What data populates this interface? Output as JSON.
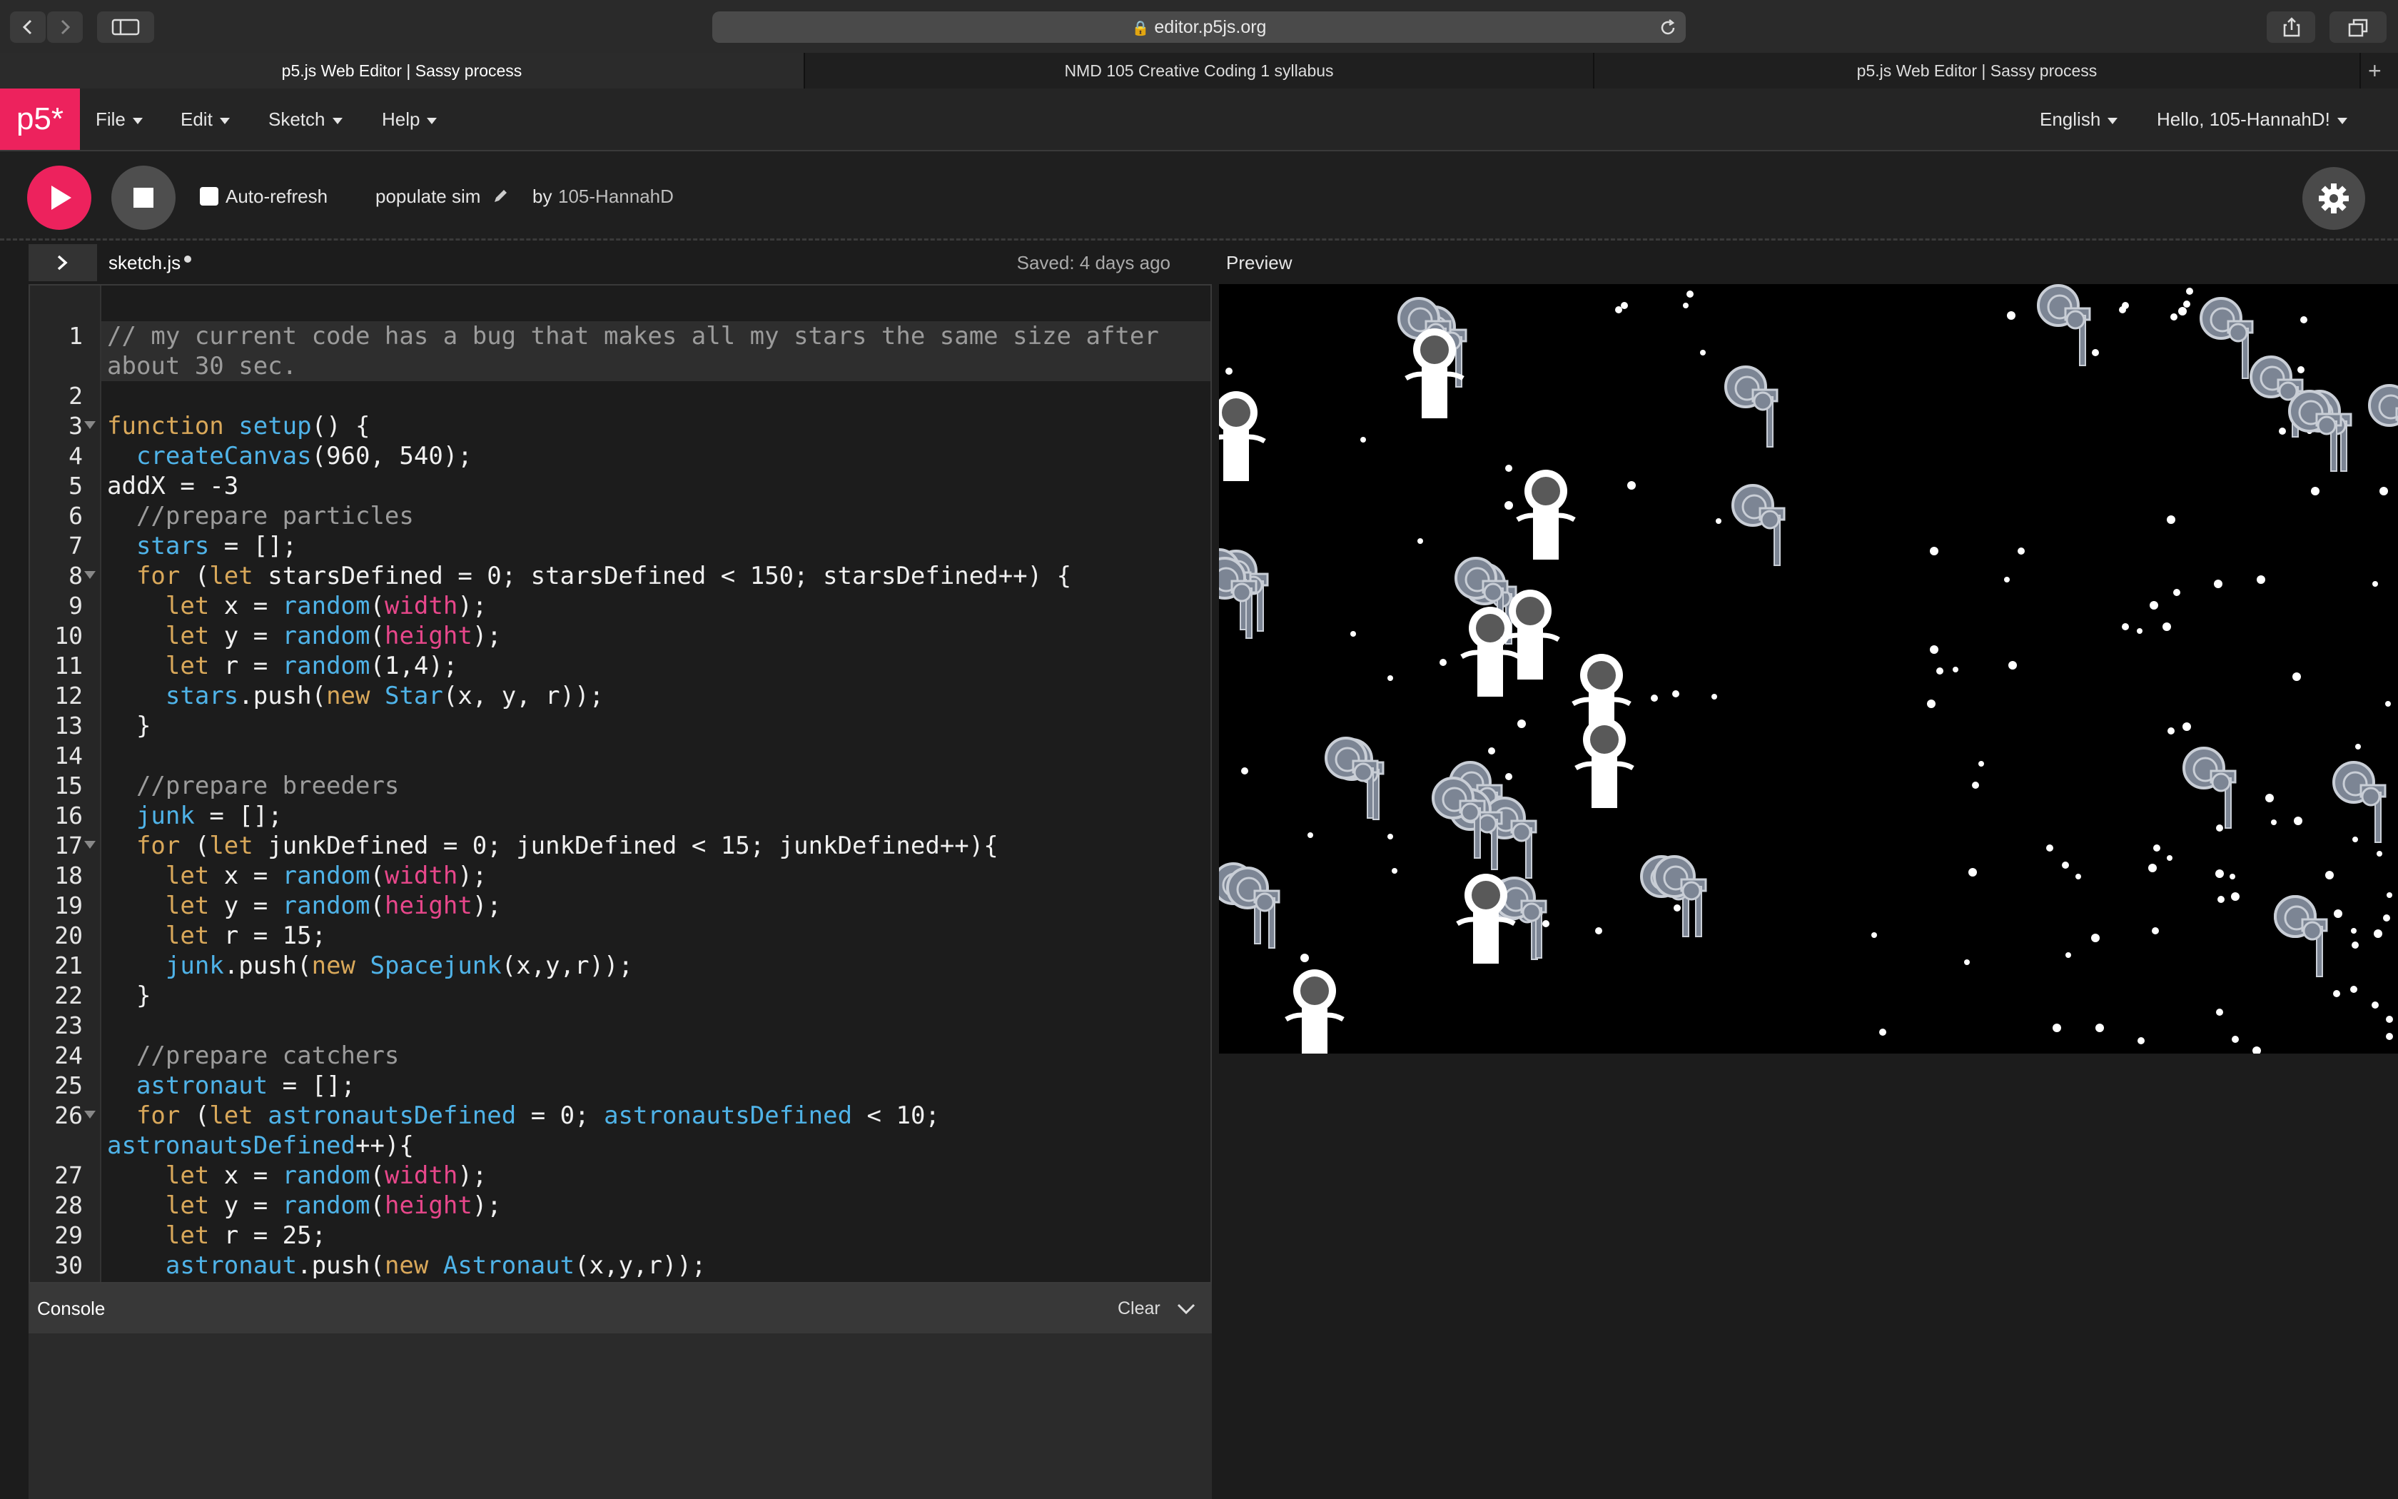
{
  "browser": {
    "url": "editor.p5js.org",
    "tabs": [
      {
        "title": "p5.js Web Editor | Sassy process",
        "active": true
      },
      {
        "title": "NMD 105 Creative Coding 1 syllabus",
        "active": false
      },
      {
        "title": "p5.js Web Editor | Sassy process",
        "active": false
      }
    ]
  },
  "nav": {
    "logo": "p5*",
    "menus": [
      "File",
      "Edit",
      "Sketch",
      "Help"
    ],
    "language": "English",
    "user": "Hello, 105-HannahD!"
  },
  "toolbar": {
    "auto_refresh_label": "Auto-refresh",
    "auto_refresh_checked": false,
    "sketch_name": "populate sim",
    "by_label": "by",
    "author": "105-HannahD"
  },
  "editor": {
    "file_name": "sketch.js",
    "saved_status": "Saved: 4 days ago",
    "line_numbers": [
      "1",
      "",
      "2",
      "3",
      "4",
      "5",
      "6",
      "7",
      "8",
      "9",
      "10",
      "11",
      "12",
      "13",
      "14",
      "15",
      "16",
      "17",
      "18",
      "19",
      "20",
      "21",
      "22",
      "23",
      "24",
      "25",
      "26",
      "",
      "27",
      "28",
      "29",
      "30"
    ],
    "code_lines": [
      "// my current code has a bug that makes all my stars the same size after",
      "about 30 sec.",
      "",
      "function setup() {",
      "  createCanvas(960, 540);",
      "addX = -3",
      "  //prepare particles",
      "  stars = [];",
      "  for (let starsDefined = 0; starsDefined < 150; starsDefined++) {",
      "    let x = random(width);",
      "    let y = random(height);",
      "    let r = random(1,4);",
      "    stars.push(new Star(x, y, r));",
      "  }",
      "",
      "  //prepare breeders",
      "  junk = [];",
      "  for (let junkDefined = 0; junkDefined < 15; junkDefined++){",
      "    let x = random(width);",
      "    let y = random(height);",
      "    let r = 15;",
      "    junk.push(new Spacejunk(x,y,r));",
      "  }",
      "",
      "  //prepare catchers",
      "  astronaut = [];",
      "  for (let astronautsDefined = 0; astronautsDefined < 10;",
      "astronautsDefined++){",
      "    let x = random(width);",
      "    let y = random(height);",
      "    let r = 25;",
      "    astronaut.push(new Astronaut(x,y,r));"
    ]
  },
  "preview": {
    "label": "Preview"
  },
  "console": {
    "title": "Console",
    "clear_label": "Clear"
  },
  "colors": {
    "accent": "#ed225d",
    "keyword": "#d9a85a",
    "function": "#4fb3e8",
    "builtin": "#e8478b",
    "comment": "#9b9b9b"
  }
}
